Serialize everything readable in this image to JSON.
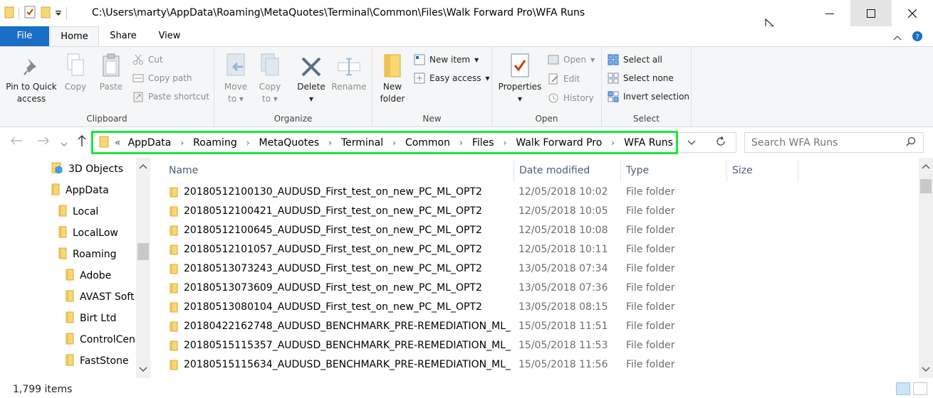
{
  "window": {
    "title": "C:\\Users\\marty\\AppData\\Roaming\\MetaQuotes\\Terminal\\Common\\Files\\Walk Forward Pro\\WFA Runs",
    "minimize": "—",
    "maximize": "☐",
    "close": "✕"
  },
  "ribbon_tabs": {
    "file": "File",
    "home": "Home",
    "share": "Share",
    "view": "View"
  },
  "ribbon": {
    "clipboard": {
      "label": "Clipboard",
      "pin_line1": "Pin to Quick",
      "pin_line2": "access",
      "copy": "Copy",
      "paste": "Paste",
      "cut": "Cut",
      "copy_path": "Copy path",
      "paste_shortcut": "Paste shortcut"
    },
    "organize": {
      "label": "Organize",
      "move_line1": "Move",
      "move_line2": "to",
      "copy_line1": "Copy",
      "copy_line2": "to",
      "delete": "Delete",
      "rename": "Rename"
    },
    "new": {
      "label": "New",
      "new_folder_line1": "New",
      "new_folder_line2": "folder",
      "new_item": "New item",
      "easy_access": "Easy access"
    },
    "open": {
      "label": "Open",
      "properties": "Properties",
      "open": "Open",
      "edit": "Edit",
      "history": "History"
    },
    "select": {
      "label": "Select",
      "select_all": "Select all",
      "select_none": "Select none",
      "invert_selection": "Invert selection"
    }
  },
  "address": {
    "overflow": "«",
    "crumbs": [
      "AppData",
      "Roaming",
      "MetaQuotes",
      "Terminal",
      "Common",
      "Files",
      "Walk Forward Pro",
      "WFA Runs"
    ],
    "separator": "›"
  },
  "search": {
    "placeholder": "Search WFA Runs"
  },
  "nav_tree": [
    {
      "label": "3D Objects",
      "icon": "3d-objects-icon"
    },
    {
      "label": "AppData",
      "icon": "folder-icon"
    },
    {
      "label": "Local",
      "icon": "folder-icon"
    },
    {
      "label": "LocalLow",
      "icon": "folder-icon"
    },
    {
      "label": "Roaming",
      "icon": "folder-icon"
    },
    {
      "label": "Adobe",
      "icon": "folder-icon"
    },
    {
      "label": "AVAST Soft",
      "icon": "folder-icon"
    },
    {
      "label": "Birt Ltd",
      "icon": "folder-icon"
    },
    {
      "label": "ControlCen",
      "icon": "folder-icon"
    },
    {
      "label": "FastStone",
      "icon": "folder-icon"
    }
  ],
  "columns": {
    "name": "Name",
    "date": "Date modified",
    "type": "Type",
    "size": "Size"
  },
  "files": [
    {
      "name": "20180512100130_AUDUSD_First_test_on_new_PC_ML_OPT2",
      "date": "12/05/2018 10:02",
      "type": "File folder"
    },
    {
      "name": "20180512100421_AUDUSD_First_test_on_new_PC_ML_OPT2",
      "date": "12/05/2018 10:05",
      "type": "File folder"
    },
    {
      "name": "20180512100645_AUDUSD_First_test_on_new_PC_ML_OPT2",
      "date": "12/05/2018 10:08",
      "type": "File folder"
    },
    {
      "name": "20180512101057_AUDUSD_First_test_on_new_PC_ML_OPT2",
      "date": "12/05/2018 10:11",
      "type": "File folder"
    },
    {
      "name": "20180513073243_AUDUSD_First_test_on_new_PC_ML_OPT2",
      "date": "13/05/2018 07:34",
      "type": "File folder"
    },
    {
      "name": "20180513073609_AUDUSD_First_test_on_new_PC_ML_OPT2",
      "date": "13/05/2018 07:36",
      "type": "File folder"
    },
    {
      "name": "20180513080104_AUDUSD_First_test_on_new_PC_ML_OPT2",
      "date": "13/05/2018 08:15",
      "type": "File folder"
    },
    {
      "name": "20180422162748_AUDUSD_BENCHMARK_PRE-REMEDIATION_ML_...",
      "date": "15/05/2018 11:51",
      "type": "File folder"
    },
    {
      "name": "20180515115357_AUDUSD_BENCHMARK_PRE-REMEDIATION_ML_...",
      "date": "15/05/2018 11:53",
      "type": "File folder"
    },
    {
      "name": "20180515115634_AUDUSD_BENCHMARK_PRE-REMEDIATION_ML_...",
      "date": "15/05/2018 11:56",
      "type": "File folder"
    }
  ],
  "status": {
    "item_count": "1,799 items"
  },
  "colors": {
    "accent": "#1a6ec5",
    "highlight_border": "#18e83b",
    "folder": "#f8d775"
  }
}
